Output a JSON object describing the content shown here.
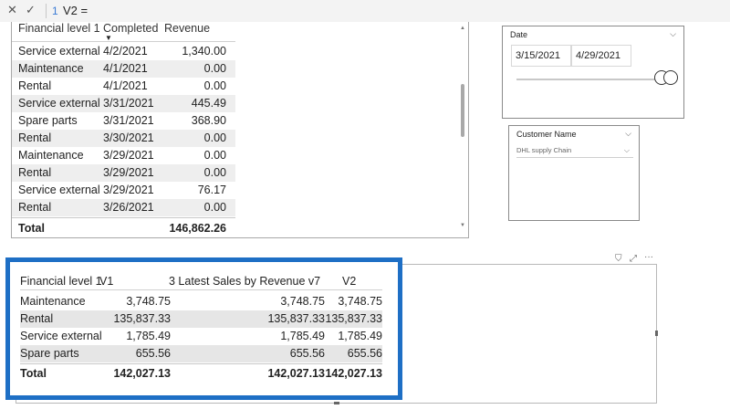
{
  "formula_bar": {
    "line_number": "1",
    "formula": "V2 ="
  },
  "top_table": {
    "headers": [
      "Financial level 1",
      "Completed",
      "Revenue"
    ],
    "rows": [
      [
        "Service external",
        "4/2/2021",
        "1,340.00"
      ],
      [
        "Maintenance",
        "4/1/2021",
        "0.00"
      ],
      [
        "Rental",
        "4/1/2021",
        "0.00"
      ],
      [
        "Service external",
        "3/31/2021",
        "445.49"
      ],
      [
        "Spare parts",
        "3/31/2021",
        "368.90"
      ],
      [
        "Rental",
        "3/30/2021",
        "0.00"
      ],
      [
        "Maintenance",
        "3/29/2021",
        "0.00"
      ],
      [
        "Rental",
        "3/29/2021",
        "0.00"
      ],
      [
        "Service external",
        "3/29/2021",
        "76.17"
      ],
      [
        "Rental",
        "3/26/2021",
        "0.00"
      ]
    ],
    "total_label": "Total",
    "total_value": "146,862.26"
  },
  "date_slicer": {
    "title": "Date",
    "start": "3/15/2021",
    "end": "4/29/2021"
  },
  "customer_slicer": {
    "title": "Customer Name",
    "selected": "DHL supply Chain"
  },
  "bottom_table": {
    "headers": [
      "Financial level 1",
      "V1",
      "3 Latest Sales by Revenue v7",
      "V2"
    ],
    "rows": [
      [
        "Maintenance",
        "3,748.75",
        "3,748.75",
        "3,748.75"
      ],
      [
        "Rental",
        "135,837.33",
        "135,837.33",
        "135,837.33"
      ],
      [
        "Service external",
        "1,785.49",
        "1,785.49",
        "1,785.49"
      ],
      [
        "Spare parts",
        "655.56",
        "655.56",
        "655.56"
      ]
    ],
    "total": [
      "Total",
      "142,027.13",
      "142,027.13",
      "142,027.13"
    ]
  },
  "colors": {
    "highlight": "#1e6fc5",
    "row_alt": "#eeeeee",
    "formula_accent": "#3a7bd5"
  },
  "icons": [
    "close-icon",
    "check-icon",
    "sort-desc-icon",
    "chevron-down-icon",
    "filter-icon",
    "focus-mode-icon",
    "more-options-icon"
  ]
}
